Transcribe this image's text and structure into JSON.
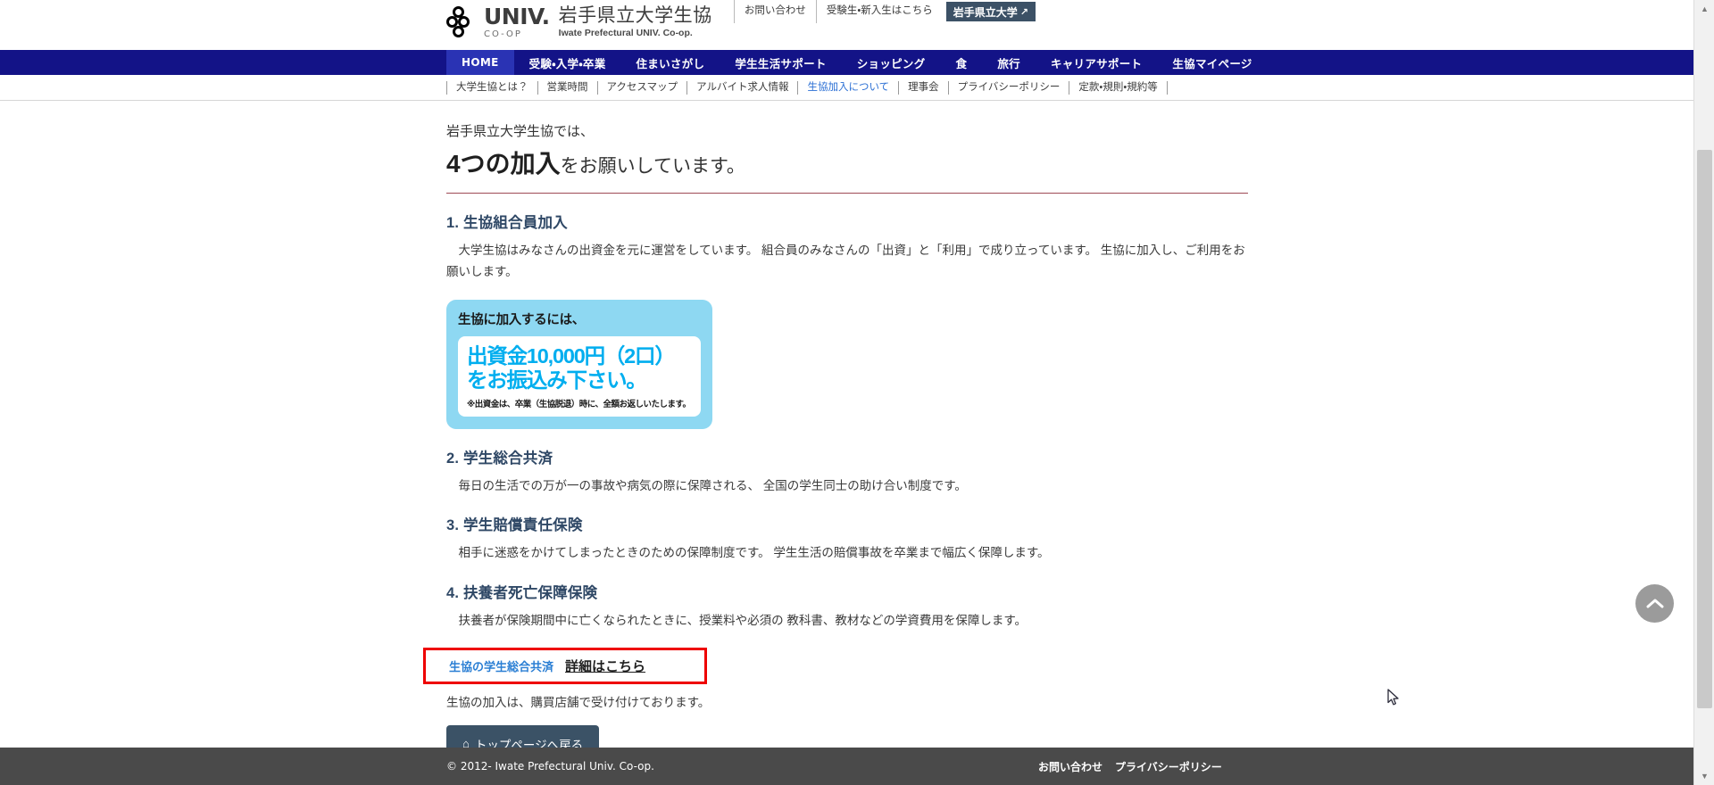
{
  "header": {
    "logo": {
      "mark_alt": "univ-coop-logo",
      "univ_text": "UNIV.",
      "coop_text": "CO-OP",
      "name_jp": "岩手県立大学生協",
      "name_en": "Iwate Prefectural UNIV. Co-op."
    },
    "util_nav": [
      {
        "label": "お問い合わせ"
      },
      {
        "label": "受験生・新入生はこちら"
      }
    ],
    "util_button": {
      "label": "岩手県立大学",
      "icon": "external-link-icon",
      "glyph": "↗"
    }
  },
  "main_nav": {
    "items": [
      {
        "label": "HOME",
        "active": true
      },
      {
        "label": "受験・入学・卒業",
        "active": false
      },
      {
        "label": "住まいさがし",
        "active": false
      },
      {
        "label": "学生生活サポート",
        "active": false
      },
      {
        "label": "ショッピング",
        "active": false
      },
      {
        "label": "食",
        "active": false
      },
      {
        "label": "旅行",
        "active": false
      },
      {
        "label": "キャリアサポート",
        "active": false
      },
      {
        "label": "生協マイページ",
        "active": false
      }
    ]
  },
  "sub_nav": {
    "items": [
      {
        "label": "大学生協とは？",
        "current": false
      },
      {
        "label": "営業時間",
        "current": false
      },
      {
        "label": "アクセスマップ",
        "current": false
      },
      {
        "label": "アルバイト求人情報",
        "current": false
      },
      {
        "label": "生協加入について",
        "current": true
      },
      {
        "label": "理事会",
        "current": false
      },
      {
        "label": "プライバシーポリシー",
        "current": false
      },
      {
        "label": "定款・規則・規約等",
        "current": false
      }
    ]
  },
  "main": {
    "lead": "岩手県立大学生協では、",
    "headline_strong": "4つの加入",
    "headline_rest": "をお願いしています。",
    "sections": [
      {
        "title": "1. 生協組合員加入",
        "body": "大学生協はみなさんの出資金を元に運営をしています。 組合員のみなさんの「出資」と「利用」で成り立っています。 生協に加入し、ご利用をお願いします。"
      },
      {
        "title": "2. 学生総合共済",
        "body": "毎日の生活での万が一の事故や病気の際に保障される、 全国の学生同士の助け合い制度です。"
      },
      {
        "title": "3. 学生賠償責任保険",
        "body": "相手に迷惑をかけてしまったときのための保障制度です。 学生生活の賠償事故を卒業まで幅広く保障します。"
      },
      {
        "title": "4. 扶養者死亡保障保険",
        "body": "扶養者が保険期間中に亡くなられたときに、授業料や必須の 教科書、教材などの学資費用を保障します。"
      }
    ],
    "callout": {
      "lead": "生協に加入するには、",
      "line1": "出資金10,000円（2口）",
      "line2": "をお振込み下さい。",
      "note": "※出資金は、卒業（生協脱退）時に、全額お返しいたします。",
      "bg_color": "#8ed8f2",
      "text_color": "#00aeef"
    },
    "highlight_box": {
      "link_label": "生協の学生総合共済",
      "detail_label": "詳細はこちら",
      "border_color": "#ee0000"
    },
    "tail_note": "生協の加入は、購買店舗で受け付けております。",
    "top_button": {
      "label": "トップページへ戻る",
      "icon": "home-icon",
      "glyph": "⌂"
    }
  },
  "footer": {
    "copyright": "© 2012- Iwate Prefectural Univ. Co-op.",
    "links": [
      {
        "label": "お問い合わせ"
      },
      {
        "label": "プライバシーポリシー"
      }
    ]
  },
  "scroll_top": {
    "icon": "chevron-up-icon",
    "label": "ページトップへ戻る"
  },
  "scrollbar": {
    "up_glyph": "▲",
    "down_glyph": "▼"
  }
}
